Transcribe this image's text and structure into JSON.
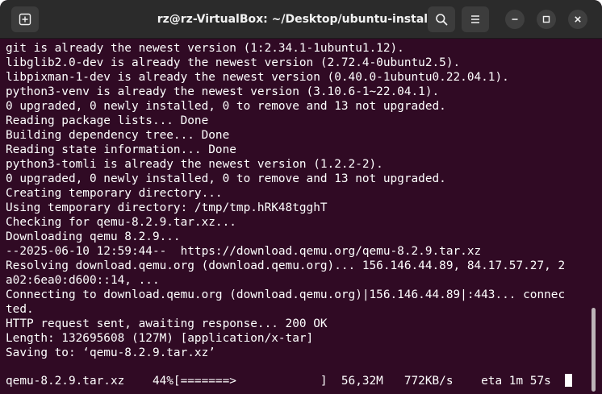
{
  "window": {
    "title": "rz@rz-VirtualBox: ~/Desktop/ubuntu-installer"
  },
  "icons": {
    "new_tab": "new-tab-icon",
    "search": "search-icon",
    "menu": "hamburger-menu-icon",
    "minimize": "minimize-icon",
    "maximize": "maximize-icon",
    "close": "close-icon"
  },
  "colors": {
    "terminal_bg": "#300a24",
    "titlebar_bg": "#2b2b2b",
    "text": "#ffffff"
  },
  "terminal": {
    "lines": [
      "git is already the newest version (1:2.34.1-1ubuntu1.12).",
      "libglib2.0-dev is already the newest version (2.72.4-0ubuntu2.5).",
      "libpixman-1-dev is already the newest version (0.40.0-1ubuntu0.22.04.1).",
      "python3-venv is already the newest version (3.10.6-1~22.04.1).",
      "0 upgraded, 0 newly installed, 0 to remove and 13 not upgraded.",
      "Reading package lists... Done",
      "Building dependency tree... Done",
      "Reading state information... Done",
      "python3-tomli is already the newest version (1.2.2-2).",
      "0 upgraded, 0 newly installed, 0 to remove and 13 not upgraded.",
      "Creating temporary directory...",
      "Using temporary directory: /tmp/tmp.hRK48tgghT",
      "Checking for qemu-8.2.9.tar.xz...",
      "Downloading qemu 8.2.9...",
      "--2025-06-10 12:59:44--  https://download.qemu.org/qemu-8.2.9.tar.xz",
      "Resolving download.qemu.org (download.qemu.org)... 156.146.44.89, 84.17.57.27, 2",
      "a02:6ea0:d600::14, ...",
      "Connecting to download.qemu.org (download.qemu.org)|156.146.44.89|:443... connec",
      "ted.",
      "HTTP request sent, awaiting response... 200 OK",
      "Length: 132695608 (127M) [application/x-tar]",
      "Saving to: ‘qemu-8.2.9.tar.xz’"
    ],
    "progress": "qemu-8.2.9.tar.xz    44%[=======>            ]  56,32M   772KB/s    eta 1m 57s  "
  },
  "scrollbar": {
    "position": 0.87
  }
}
